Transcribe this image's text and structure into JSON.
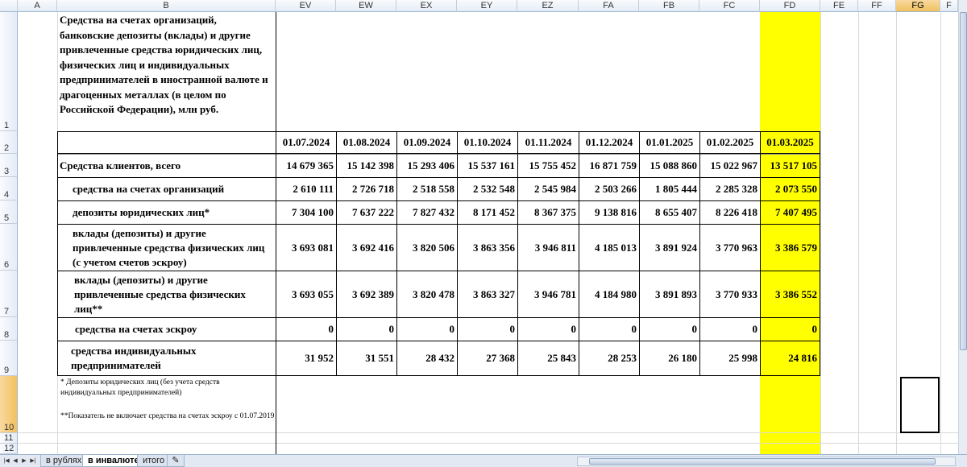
{
  "columns": {
    "A": "A",
    "B": "B",
    "EV": "EV",
    "EW": "EW",
    "EX": "EX",
    "EY": "EY",
    "EZ": "EZ",
    "FA": "FA",
    "FB": "FB",
    "FC": "FC",
    "FD": "FD",
    "FE": "FE",
    "FF": "FF",
    "FG": "FG",
    "FH": "F"
  },
  "rows": [
    "1",
    "2",
    "3",
    "4",
    "5",
    "6",
    "7",
    "8",
    "9",
    "10",
    "11",
    "12"
  ],
  "title": "Средства на счетах организаций, банковские депозиты (вклады) и другие привлеченные средства юридических лиц, физических лиц и индивидуальных предпринимателей в иностранной валюте и драгоценных металлах (в целом по Российской Федерации), млн руб.",
  "dates": [
    "01.07.2024",
    "01.08.2024",
    "01.09.2024",
    "01.10.2024",
    "01.11.2024",
    "01.12.2024",
    "01.01.2025",
    "01.02.2025",
    "01.03.2025"
  ],
  "table": [
    {
      "label": "Средства клиентов, всего",
      "values": [
        "14 679 365",
        "15 142 398",
        "15 293 406",
        "15 537 161",
        "15 755 452",
        "16 871 759",
        "15 088 860",
        "15 022 967",
        "13 517 105"
      ]
    },
    {
      "label": "средства на счетах организаций",
      "values": [
        "2 610 111",
        "2 726 718",
        "2 518 558",
        "2 532 548",
        "2 545 984",
        "2 503 266",
        "1 805 444",
        "2 285 328",
        "2 073 550"
      ]
    },
    {
      "label": "депозиты юридических лиц*",
      "values": [
        "7 304 100",
        "7 637 222",
        "7 827 432",
        "8 171 452",
        "8 367 375",
        "9 138 816",
        "8 655 407",
        "8 226 418",
        "7 407 495"
      ]
    },
    {
      "label": "вклады (депозиты) и другие привлеченные средства физических лиц (с учетом счетов эскроу)",
      "values": [
        "3 693 081",
        "3 692 416",
        "3 820 506",
        "3 863 356",
        "3 946 811",
        "4 185 013",
        "3 891 924",
        "3 770 963",
        "3 386 579"
      ]
    },
    {
      "label": "вклады (депозиты) и другие привлеченные средства физических лиц**",
      "values": [
        "3 693 055",
        "3 692 389",
        "3 820 478",
        "3 863 327",
        "3 946 781",
        "4 184 980",
        "3 891 893",
        "3 770 933",
        "3 386 552"
      ]
    },
    {
      "label": "средства на счетах эскроу",
      "values": [
        "0",
        "0",
        "0",
        "0",
        "0",
        "0",
        "0",
        "0",
        "0"
      ]
    },
    {
      "label": "средства индивидуальных предпринимателей",
      "values": [
        "31 952",
        "31 551",
        "28 432",
        "27 368",
        "25 843",
        "28 253",
        "26 180",
        "25 998",
        "24 816"
      ]
    }
  ],
  "notes": {
    "note1": "* Депозиты юридических лиц (без учета средств индивидуальных предпринимателей)",
    "note2": "**Показатель не включает средства на счетах эскроу с 01.07.2019"
  },
  "sheet_tabs": [
    "в рублях",
    "в инвалюте",
    "итого"
  ],
  "active_tab": "в инвалюте",
  "colors": {
    "highlight": "#ffff00",
    "header_selected": "#f1c15f"
  }
}
